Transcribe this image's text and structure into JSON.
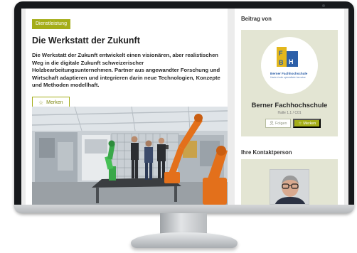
{
  "article": {
    "category": "Dienstleistung",
    "title": "Die Werkstatt der Zukunft",
    "lead": "Die Werkstatt der Zukunft entwickelt einen visionären, aber realistischen Weg in die digitale Zukunft schweizerischer Holzbearbeitungsunternehmen. Partner aus angewandter Forschung und Wirtschaft adaptieren und integrieren darin neue Technologien, Konzepte und Methoden modellhaft.",
    "bookmark_label": "Merken"
  },
  "sidebar": {
    "contribution_heading": "Beitrag von",
    "organization": {
      "logo_letters": "F H B",
      "logo_name": "Berner Fachhochschule",
      "logo_subtitle": "Haute école spécialisée bernoise",
      "name": "Berner Fachhochschule",
      "meta": "Halle 1.1 / C01",
      "follow_label": "Folgen",
      "bookmark_label": "Merken"
    },
    "contact_heading": "Ihre Kontaktperson"
  },
  "icons": {
    "star": "star-icon",
    "person": "person-icon"
  },
  "colors": {
    "accent": "#a4ad17",
    "panel": "#e3e5d3",
    "bfh_blue": "#2c5fa8",
    "bfh_yellow": "#e3b71c"
  }
}
